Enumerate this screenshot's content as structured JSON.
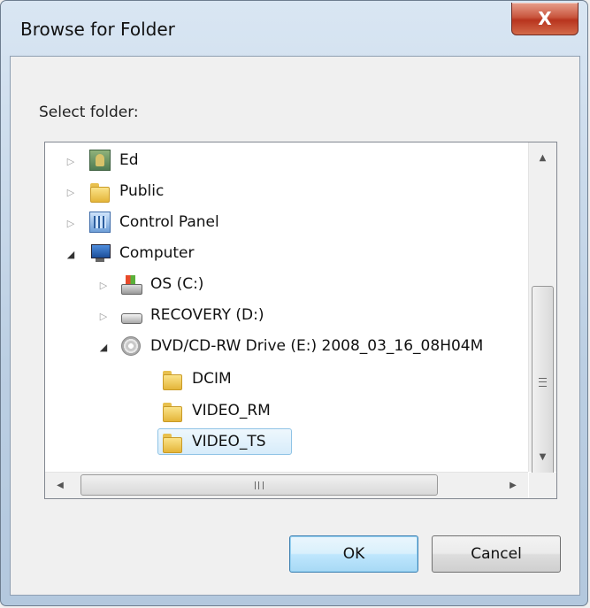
{
  "window": {
    "title": "Browse for Folder",
    "close_glyph": "X"
  },
  "prompt": "Select folder:",
  "tree": {
    "nodes": [
      {
        "label": "Ed",
        "icon": "user-icon",
        "expander": "collapsed"
      },
      {
        "label": "Public",
        "icon": "folder-icon",
        "expander": "collapsed"
      },
      {
        "label": "Control Panel",
        "icon": "control-panel-icon",
        "expander": "collapsed"
      },
      {
        "label": "Computer",
        "icon": "computer-icon",
        "expander": "expanded"
      },
      {
        "label": "OS (C:)",
        "icon": "os-drive-icon",
        "expander": "collapsed"
      },
      {
        "label": "RECOVERY (D:)",
        "icon": "hard-drive-icon",
        "expander": "collapsed"
      },
      {
        "label": "DVD/CD-RW Drive (E:) 2008_03_16_08H04M",
        "icon": "dvd-drive-icon",
        "expander": "expanded"
      },
      {
        "label": "DCIM",
        "icon": "folder-icon",
        "expander": "none"
      },
      {
        "label": "VIDEO_RM",
        "icon": "folder-icon",
        "expander": "none"
      },
      {
        "label": "VIDEO_TS",
        "icon": "folder-icon",
        "expander": "none",
        "selected": true
      }
    ]
  },
  "scrollbars": {
    "up_glyph": "▲",
    "down_glyph": "▼",
    "left_glyph": "◀",
    "right_glyph": "▶"
  },
  "buttons": {
    "ok": "OK",
    "cancel": "Cancel"
  },
  "colors": {
    "selection": "#e5f3fb",
    "close_button": "#c9573f"
  }
}
